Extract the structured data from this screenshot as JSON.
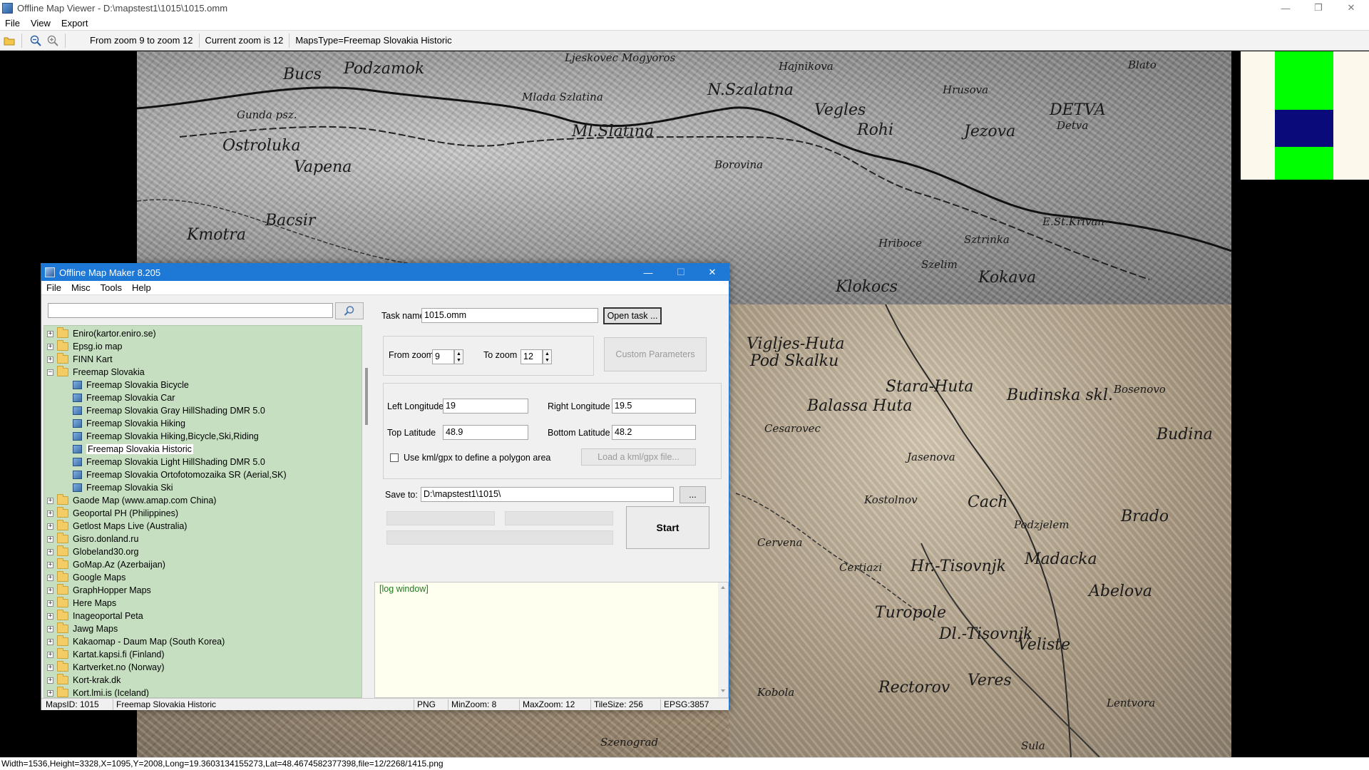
{
  "viewer": {
    "title": "Offline Map Viewer - D:\\mapstest1\\1015\\1015.omm",
    "menu": [
      "File",
      "View",
      "Export"
    ],
    "toolbar": {
      "zoom_range": "From zoom 9 to zoom 12",
      "current_zoom": "Current zoom is 12",
      "maps_type": "MapsType=Freemap Slovakia Historic"
    },
    "statusbar": "Width=1536,Height=3328,X=1095,Y=2008,Long=19.3603134155273,Lat=48.4674582377398,file=12/2268/1415.png"
  },
  "map_labels": [
    "Podzamok",
    "Bucs",
    "Ljeskovec Mogyoros",
    "N.Szalatna",
    "Hajnikova",
    "Hrusova",
    "Blato",
    "Gunda psz.",
    "Mlada Szlatina",
    "Ml.Slatina",
    "Vegles",
    "DETVA",
    "Detva",
    "Ostroluka",
    "Vapena",
    "Rohi",
    "Jezova",
    "Bacsir",
    "Kmotra",
    "Borovina",
    "Hriboce",
    "Sztrinka",
    "E.St.Krivan",
    "Szelim",
    "Kokava",
    "Klokocs",
    "Vigljes-Huta",
    "Pod Skalku",
    "Stara-Huta",
    "Budinska skl.",
    "Bosenovo",
    "Balassa Huta",
    "Cesarovec",
    "Jasenova",
    "Budina",
    "Kostolnov",
    "Cach",
    "Podzjelem",
    "Brado",
    "Cervena",
    "Certiazi",
    "Hr.-Tisovnjk",
    "Madacka",
    "Abelova",
    "Turopole",
    "Dl.-Tisovnjk",
    "Veliste",
    "Lentvora",
    "Veres",
    "Rectorov",
    "Kobola",
    "Szenograd",
    "Sula"
  ],
  "dialog": {
    "title": "Offline Map Maker 8.205",
    "menu": [
      "File",
      "Misc",
      "Tools",
      "Help"
    ],
    "search_value": "",
    "tree": [
      {
        "label": "Eniro(kartor.eniro.se)",
        "type": "folder",
        "expanded": false
      },
      {
        "label": "Epsg.io map",
        "type": "folder",
        "expanded": false
      },
      {
        "label": "FINN Kart",
        "type": "folder",
        "expanded": false
      },
      {
        "label": "Freemap Slovakia",
        "type": "folder",
        "expanded": true
      },
      {
        "label": "Freemap Slovakia Bicycle",
        "type": "map"
      },
      {
        "label": "Freemap Slovakia Car",
        "type": "map"
      },
      {
        "label": "Freemap Slovakia Gray HillShading DMR 5.0",
        "type": "map"
      },
      {
        "label": "Freemap Slovakia Hiking",
        "type": "map"
      },
      {
        "label": "Freemap Slovakia Hiking,Bicycle,Ski,Riding",
        "type": "map"
      },
      {
        "label": "Freemap Slovakia Historic",
        "type": "map"
      },
      {
        "label": "Freemap Slovakia Light HillShading DMR 5.0",
        "type": "map"
      },
      {
        "label": "Freemap Slovakia Ortofotomozaika SR (Aerial,SK)",
        "type": "map"
      },
      {
        "label": "Freemap Slovakia Ski",
        "type": "map"
      },
      {
        "label": "Gaode Map (www.amap.com China)",
        "type": "folder",
        "expanded": false
      },
      {
        "label": "Geoportal PH (Philippines)",
        "type": "folder",
        "expanded": false
      },
      {
        "label": "Getlost Maps Live (Australia)",
        "type": "folder",
        "expanded": false
      },
      {
        "label": "Gisro.donland.ru",
        "type": "folder",
        "expanded": false
      },
      {
        "label": "Globeland30.org",
        "type": "folder",
        "expanded": false
      },
      {
        "label": "GoMap.Az (Azerbaijan)",
        "type": "folder",
        "expanded": false
      },
      {
        "label": "Google Maps",
        "type": "folder",
        "expanded": false
      },
      {
        "label": "GraphHopper Maps",
        "type": "folder",
        "expanded": false
      },
      {
        "label": "Here Maps",
        "type": "folder",
        "expanded": false
      },
      {
        "label": "Inageoportal Peta",
        "type": "folder",
        "expanded": false
      },
      {
        "label": "Jawg Maps",
        "type": "folder",
        "expanded": false
      },
      {
        "label": "Kakaomap - Daum Map (South Korea)",
        "type": "folder",
        "expanded": false
      },
      {
        "label": "Kartat.kapsi.fi (Finland)",
        "type": "folder",
        "expanded": false
      },
      {
        "label": "Kartverket.no (Norway)",
        "type": "folder",
        "expanded": false
      },
      {
        "label": "Kort-krak.dk",
        "type": "folder",
        "expanded": false
      },
      {
        "label": "Kort.lmi.is (Iceland)",
        "type": "folder",
        "expanded": false
      }
    ],
    "form": {
      "task_name_label": "Task name",
      "task_name_value": "1015.omm",
      "open_task_label": "Open task ...",
      "from_zoom_label": "From zoom",
      "from_zoom_value": "9",
      "to_zoom_label": "To zoom",
      "to_zoom_value": "12",
      "custom_params_label": "Custom Parameters",
      "left_lon_label": "Left Longitude",
      "left_lon_value": "19",
      "right_lon_label": "Right Longitude",
      "right_lon_value": "19.5",
      "top_lat_label": "Top Latitude",
      "top_lat_value": "48.9",
      "bottom_lat_label": "Bottom Latitude",
      "bottom_lat_value": "48.2",
      "kml_label": "Use kml/gpx to define a polygon area",
      "load_kml_label": "Load a kml/gpx file...",
      "save_to_label": "Save to:",
      "save_to_value": "D:\\mapstest1\\1015\\",
      "browse_label": "...",
      "start_label": "Start"
    },
    "log_text": "[log window]",
    "status": {
      "maps_id": "MapsID: 1015",
      "maps_name": "Freemap Slovakia Historic",
      "format": "PNG",
      "min_zoom": "MinZoom: 8",
      "max_zoom": "MaxZoom: 12",
      "tile_size": "TileSize: 256",
      "epsg": "EPSG:3857"
    }
  },
  "colors": {
    "dialog_title_bg": "#1e78d6",
    "tree_bg": "#c6dfc1",
    "log_bg": "#fffff0",
    "log_text": "#1f7a1f",
    "legend_green": "#00ff00",
    "legend_navy": "#0a0a7a"
  }
}
